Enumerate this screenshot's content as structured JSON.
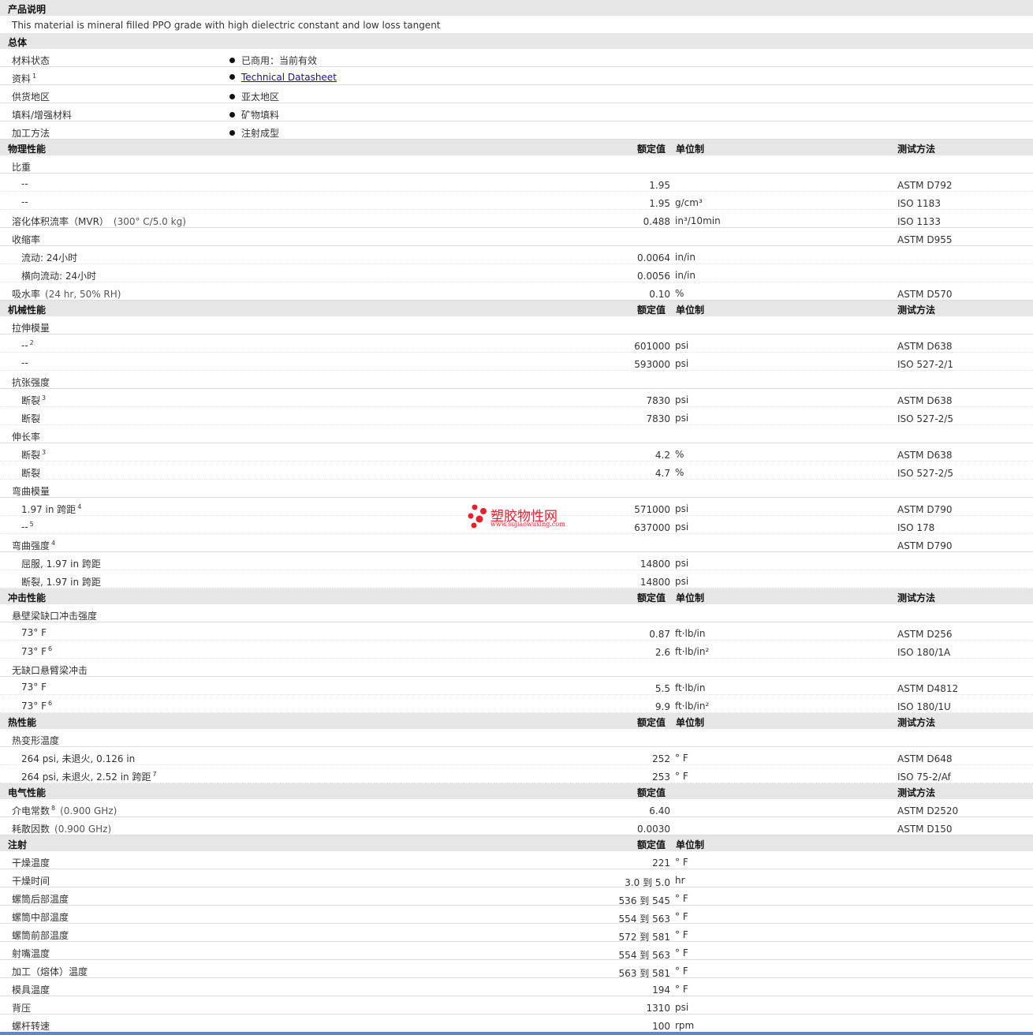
{
  "description": {
    "header": "产品说明",
    "text": "This material is mineral filled PPO grade with high dielectric constant and low loss tangent"
  },
  "general": {
    "header": "总体",
    "rows": [
      {
        "label": "材料状态",
        "sup": "",
        "value": "已商用：当前有效",
        "link": false
      },
      {
        "label": "资料",
        "sup": "1",
        "value": "Technical Datasheet",
        "link": true
      },
      {
        "label": "供货地区",
        "sup": "",
        "value": "亚太地区",
        "link": false
      },
      {
        "label": "填料/增强材料",
        "sup": "",
        "value": "矿物填料",
        "link": false
      },
      {
        "label": "加工方法",
        "sup": "",
        "value": "注射成型",
        "link": false
      }
    ]
  },
  "columns": {
    "nominal": "额定值",
    "unit": "单位制",
    "test": "测试方法"
  },
  "sections": [
    {
      "header": "物理性能",
      "show_unit_col": true,
      "show_test_col": true,
      "rows": [
        {
          "label": "比重",
          "sup": "",
          "cond": "",
          "sub": false,
          "value": "",
          "unit": "",
          "test": ""
        },
        {
          "label": "--",
          "sup": "",
          "cond": "",
          "sub": true,
          "value": "1.95",
          "unit": "",
          "test": "ASTM D792"
        },
        {
          "label": "--",
          "sup": "",
          "cond": "",
          "sub": true,
          "value": "1.95",
          "unit": "g/cm³",
          "test": "ISO 1183"
        },
        {
          "label": "溶化体积流率（MVR）",
          "sup": "",
          "cond": "(300° C/5.0 kg)",
          "sub": false,
          "value": "0.488",
          "unit": "in³/10min",
          "test": "ISO 1133"
        },
        {
          "label": "收缩率",
          "sup": "",
          "cond": "",
          "sub": false,
          "value": "",
          "unit": "",
          "test": "ASTM D955"
        },
        {
          "label": "流动: 24小时",
          "sup": "",
          "cond": "",
          "sub": true,
          "value": "0.0064",
          "unit": "in/in",
          "test": ""
        },
        {
          "label": "横向流动: 24小时",
          "sup": "",
          "cond": "",
          "sub": true,
          "value": "0.0056",
          "unit": "in/in",
          "test": ""
        },
        {
          "label": "吸水率",
          "sup": "",
          "cond": "(24 hr, 50% RH)",
          "sub": false,
          "value": "0.10",
          "unit": "%",
          "test": "ASTM D570"
        }
      ]
    },
    {
      "header": "机械性能",
      "show_unit_col": true,
      "show_test_col": true,
      "rows": [
        {
          "label": "拉伸模量",
          "sup": "",
          "cond": "",
          "sub": false,
          "value": "",
          "unit": "",
          "test": ""
        },
        {
          "label": "--",
          "sup": "2",
          "cond": "",
          "sub": true,
          "value": "601000",
          "unit": "psi",
          "test": "ASTM D638"
        },
        {
          "label": "--",
          "sup": "",
          "cond": "",
          "sub": true,
          "value": "593000",
          "unit": "psi",
          "test": "ISO 527-2/1"
        },
        {
          "label": "抗张强度",
          "sup": "",
          "cond": "",
          "sub": false,
          "value": "",
          "unit": "",
          "test": ""
        },
        {
          "label": "断裂",
          "sup": "3",
          "cond": "",
          "sub": true,
          "value": "7830",
          "unit": "psi",
          "test": "ASTM D638"
        },
        {
          "label": "断裂",
          "sup": "",
          "cond": "",
          "sub": true,
          "value": "7830",
          "unit": "psi",
          "test": "ISO 527-2/5"
        },
        {
          "label": "伸长率",
          "sup": "",
          "cond": "",
          "sub": false,
          "value": "",
          "unit": "",
          "test": ""
        },
        {
          "label": "断裂",
          "sup": "3",
          "cond": "",
          "sub": true,
          "value": "4.2",
          "unit": "%",
          "test": "ASTM D638"
        },
        {
          "label": "断裂",
          "sup": "",
          "cond": "",
          "sub": true,
          "value": "4.7",
          "unit": "%",
          "test": "ISO 527-2/5"
        },
        {
          "label": "弯曲模量",
          "sup": "",
          "cond": "",
          "sub": false,
          "value": "",
          "unit": "",
          "test": ""
        },
        {
          "label": "1.97 in 跨距",
          "sup": "4",
          "cond": "",
          "sub": true,
          "value": "571000",
          "unit": "psi",
          "test": "ASTM D790"
        },
        {
          "label": "--",
          "sup": "5",
          "cond": "",
          "sub": true,
          "value": "637000",
          "unit": "psi",
          "test": "ISO 178"
        },
        {
          "label": "弯曲强度",
          "sup": "4",
          "cond": "",
          "sub": false,
          "value": "",
          "unit": "",
          "test": "ASTM D790"
        },
        {
          "label": "屈服, 1.97 in 跨距",
          "sup": "",
          "cond": "",
          "sub": true,
          "value": "14800",
          "unit": "psi",
          "test": ""
        },
        {
          "label": "断裂, 1.97 in 跨距",
          "sup": "",
          "cond": "",
          "sub": true,
          "value": "14800",
          "unit": "psi",
          "test": ""
        }
      ]
    },
    {
      "header": "冲击性能",
      "show_unit_col": true,
      "show_test_col": true,
      "rows": [
        {
          "label": "悬壁梁缺口冲击强度",
          "sup": "",
          "cond": "",
          "sub": false,
          "value": "",
          "unit": "",
          "test": ""
        },
        {
          "label": "73° F",
          "sup": "",
          "cond": "",
          "sub": true,
          "value": "0.87",
          "unit": "ft·lb/in",
          "test": "ASTM D256"
        },
        {
          "label": "73° F",
          "sup": "6",
          "cond": "",
          "sub": true,
          "value": "2.6",
          "unit": "ft·lb/in²",
          "test": "ISO 180/1A"
        },
        {
          "label": "无缺口悬臂梁冲击",
          "sup": "",
          "cond": "",
          "sub": false,
          "value": "",
          "unit": "",
          "test": ""
        },
        {
          "label": "73° F",
          "sup": "",
          "cond": "",
          "sub": true,
          "value": "5.5",
          "unit": "ft·lb/in",
          "test": "ASTM D4812"
        },
        {
          "label": "73° F",
          "sup": "6",
          "cond": "",
          "sub": true,
          "value": "9.9",
          "unit": "ft·lb/in²",
          "test": "ISO 180/1U"
        }
      ]
    },
    {
      "header": "热性能",
      "show_unit_col": true,
      "show_test_col": true,
      "rows": [
        {
          "label": "热变形温度",
          "sup": "",
          "cond": "",
          "sub": false,
          "value": "",
          "unit": "",
          "test": ""
        },
        {
          "label": "264 psi, 未退火, 0.126 in",
          "sup": "",
          "cond": "",
          "sub": true,
          "value": "252",
          "unit": "° F",
          "test": "ASTM D648"
        },
        {
          "label": "264 psi, 未退火, 2.52 in 跨距",
          "sup": "7",
          "cond": "",
          "sub": true,
          "value": "253",
          "unit": "° F",
          "test": "ISO 75-2/Af"
        }
      ]
    },
    {
      "header": "电气性能",
      "show_unit_col": false,
      "show_test_col": true,
      "rows": [
        {
          "label": "介电常数",
          "sup": "8",
          "cond": "(0.900 GHz)",
          "sub": false,
          "value": "6.40",
          "unit": "",
          "test": "ASTM D2520"
        },
        {
          "label": "耗散因数",
          "sup": "",
          "cond": "(0.900 GHz)",
          "sub": false,
          "value": "0.0030",
          "unit": "",
          "test": "ASTM D150"
        }
      ]
    },
    {
      "header": "注射",
      "show_unit_col": true,
      "show_test_col": false,
      "rows": [
        {
          "label": "干燥温度",
          "sup": "",
          "cond": "",
          "sub": false,
          "value": "221",
          "unit": "° F",
          "test": ""
        },
        {
          "label": "干燥时间",
          "sup": "",
          "cond": "",
          "sub": false,
          "value": "3.0 到 5.0",
          "unit": "hr",
          "test": ""
        },
        {
          "label": "螺筒后部温度",
          "sup": "",
          "cond": "",
          "sub": false,
          "value": "536 到 545",
          "unit": "° F",
          "test": ""
        },
        {
          "label": "螺筒中部温度",
          "sup": "",
          "cond": "",
          "sub": false,
          "value": "554 到 563",
          "unit": "° F",
          "test": ""
        },
        {
          "label": "螺筒前部温度",
          "sup": "",
          "cond": "",
          "sub": false,
          "value": "572 到 581",
          "unit": "° F",
          "test": ""
        },
        {
          "label": "射嘴温度",
          "sup": "",
          "cond": "",
          "sub": false,
          "value": "554 到 563",
          "unit": "° F",
          "test": ""
        },
        {
          "label": "加工（熔体）温度",
          "sup": "",
          "cond": "",
          "sub": false,
          "value": "563 到 581",
          "unit": "° F",
          "test": ""
        },
        {
          "label": "模具温度",
          "sup": "",
          "cond": "",
          "sub": false,
          "value": "194",
          "unit": "° F",
          "test": ""
        },
        {
          "label": "背压",
          "sup": "",
          "cond": "",
          "sub": false,
          "value": "1310",
          "unit": "psi",
          "test": ""
        },
        {
          "label": "螺杆转速",
          "sup": "",
          "cond": "",
          "sub": false,
          "value": "100",
          "unit": "rpm",
          "test": ""
        }
      ]
    }
  ],
  "watermark": {
    "title": "塑胶物性网",
    "url": "www.sujiaowuxing.com",
    "color": "#e8202a"
  }
}
